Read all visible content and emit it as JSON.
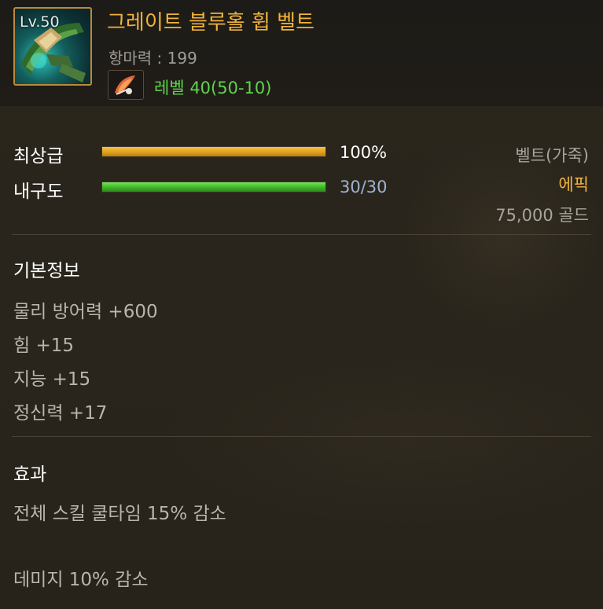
{
  "item": {
    "level_badge": "Lv.50",
    "name": "그레이트 블루홀 휩 벨트",
    "magic_resistance": "항마력 : 199",
    "level_requirement": "레벨 40(50-10)",
    "icon": "whip-belt-icon",
    "sub_icon": "feather-quill-icon"
  },
  "bars": {
    "grade": {
      "label": "최상급",
      "value_text": "100%",
      "fraction": 1.0,
      "color": "#e0a21e"
    },
    "durability": {
      "label": "내구도",
      "value_text": "30/30",
      "fraction": 1.0,
      "color": "#3fb52a"
    }
  },
  "meta": {
    "type": "벨트(가죽)",
    "rarity": "에픽",
    "rarity_color": "#f0b33c",
    "price": "75,000 골드"
  },
  "basic_info": {
    "title": "기본정보",
    "stats": [
      "물리 방어력 +600",
      "힘 +15",
      "지능 +15",
      "정신력 +17"
    ]
  },
  "effects": {
    "title": "효과",
    "lines": [
      "전체 스킬 쿨타임 15% 감소",
      "데미지 10% 감소"
    ]
  }
}
